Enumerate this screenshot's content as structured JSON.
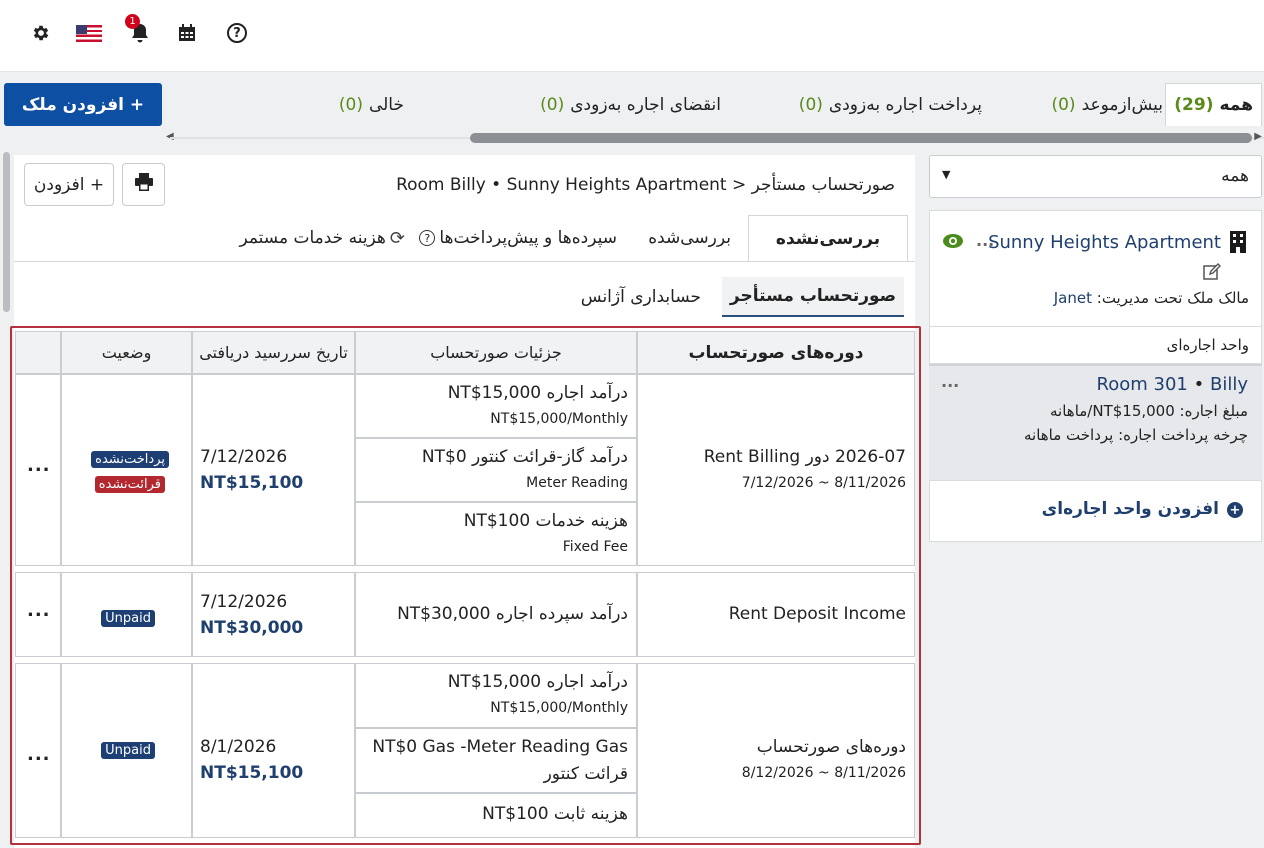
{
  "topbar": {
    "settings_icon": "gear-icon",
    "flag_icon": "us-flag-icon",
    "bell_icon": "bell-icon",
    "notification_count": "1",
    "calendar_icon": "calendar-icon",
    "help_icon": "help-circle-icon",
    "help_glyph": "?"
  },
  "add_property_button": "+ افزودن ملک",
  "filter_tabs": [
    {
      "label": "همه",
      "count": "(29)"
    },
    {
      "label": "بیش‌ازموعد",
      "count": "(0)"
    },
    {
      "label": "پرداخت اجاره به‌زودی",
      "count": "(0)"
    },
    {
      "label": "انقضای اجاره به‌زودی",
      "count": "(0)"
    },
    {
      "label": "خالی",
      "count": "(0)"
    }
  ],
  "main": {
    "add_button": "+ افزودن",
    "print_icon": "print-icon",
    "breadcrumb": "صورتحساب مستأجر < Room Billy • Sunny Heights Apartment",
    "tabs": {
      "unreviewed": "بررسی‌نشده",
      "reviewed": "بررسی‌شده",
      "deposits": "سپرده‌ها و پیش‌پرداخت‌ها",
      "recurring": "هزینه خدمات مستمر"
    },
    "subtabs": {
      "tenant_billing": "صورتحساب مستأجر",
      "agency_accounting": "حسابداری آژانس"
    }
  },
  "table": {
    "headers": {
      "periods": "دوره‌های صورتحساب",
      "details": "جزئیات صورتحساب",
      "due_date": "تاریخ سررسید دریافتی",
      "status": "وضعیت"
    },
    "rows": [
      {
        "period_title": "2026-07 دور Rent Billing",
        "period_range": "7/12/2026 ~ 8/11/2026",
        "details": [
          {
            "line1": "درآمد اجاره NT$15,000",
            "line2": "NT$15,000/Monthly"
          },
          {
            "line1": "درآمد گاز-قرائت کنتور NT$0",
            "line2": "Meter Reading"
          },
          {
            "line1": "هزینه خدمات NT$100",
            "line2": "Fixed Fee"
          }
        ],
        "due_date": "7/12/2026",
        "amount": "NT$15,100",
        "badges": [
          {
            "text": "پرداخت‌نشده",
            "color": "#1d3f74"
          },
          {
            "text": "قرائت‌نشده",
            "color": "#b3272f"
          }
        ],
        "more": "..."
      },
      {
        "period_title": "Rent Deposit Income",
        "details": [
          {
            "line1": "درآمد سپرده اجاره NT$30,000"
          }
        ],
        "due_date": "7/12/2026",
        "amount": "NT$30,000",
        "badges": [
          {
            "text": "Unpaid",
            "color": "#1d3f74"
          }
        ],
        "more": "..."
      },
      {
        "period_title": "دوره‌های صورتحساب",
        "period_range": "8/12/2026 ~ 8/11/2026",
        "details": [
          {
            "line1": "درآمد اجاره NT$15,000",
            "line2": "NT$15,000/Monthly"
          },
          {
            "line1": "NT$0 Gas -Meter Reading Gas",
            "line2": "قرائت کنتور"
          },
          {
            "line1": "هزینه ثابت NT$100"
          }
        ],
        "due_date": "8/1/2026",
        "amount": "NT$15,100",
        "badges": [
          {
            "text": "Unpaid",
            "color": "#1d3f74"
          }
        ],
        "more": "..."
      }
    ]
  },
  "right_panel": {
    "dropdown_value": "همه",
    "property": {
      "name": "Sunny Heights Apartment",
      "building_icon": "building-icon",
      "eye_icon": "eye-icon",
      "edit_icon": "edit-icon",
      "managed_label": "مالک ملک تحت مدیریت:",
      "owner": "Janet",
      "more": "..."
    },
    "unit_header": "واحد اجاره‌ای",
    "unit": {
      "room": "Room 301",
      "separator": "•",
      "tenant": "Billy",
      "rent": "مبلغ اجاره: NT$15,000/ماهانه",
      "cycle": "چرخه پرداخت اجاره: پرداخت ماهانه",
      "more": "..."
    },
    "add_unit": "افزودن واحد اجاره‌ای"
  },
  "colors": {
    "primary": "#0d4fa3",
    "amount": "#1f3f6e",
    "count_green": "#5a8a1a",
    "highlight_border": "#b3313a",
    "unpaid_badge": "#1d3f74",
    "unread_badge": "#b3272f",
    "eye_green": "#4a8c1c"
  }
}
